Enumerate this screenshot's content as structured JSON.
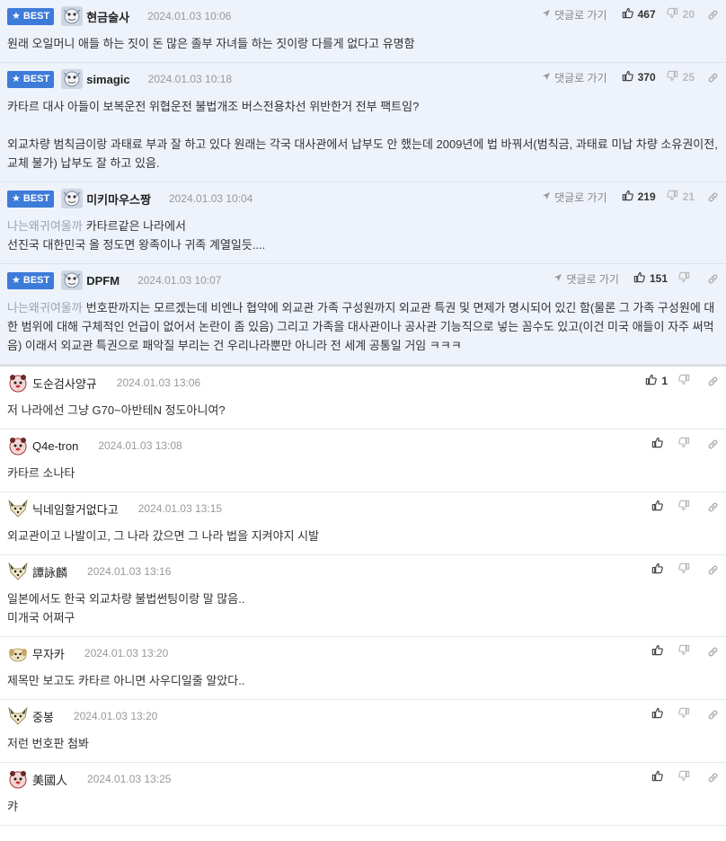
{
  "labels": {
    "best": "BEST",
    "reply": "댓글로 가기"
  },
  "colors": {
    "best_badge": "#3d7bd9",
    "best_bg": "#eef2fa",
    "mention": "#9aa3b5"
  },
  "best_comments": [
    {
      "nick": "현금술사",
      "date": "2024.01.03 10:06",
      "likes": "467",
      "dislikes": "20",
      "lines": [
        "원래 오일머니 애들 하는 짓이 돈 많은 졸부 자녀들 하는 짓이랑 다를게 없다고 유명함"
      ]
    },
    {
      "nick": "simagic",
      "date": "2024.01.03 10:18",
      "likes": "370",
      "dislikes": "25",
      "lines": [
        "카타르 대사 아들이 보복운전 위협운전 불법개조 버스전용차선 위반한거 전부 팩트임?",
        "",
        "외교차량 범칙금이랑 과태료 부과 잘 하고 있다 원래는 각국 대사관에서 납부도 안 했는데 2009년에 법 바꿔서(범칙금, 과태료 미납 차량 소유권이전, 교체 불가) 납부도 잘 하고 있음."
      ]
    },
    {
      "nick": "미키마우스짱",
      "date": "2024.01.03 10:04",
      "likes": "219",
      "dislikes": "21",
      "mention": "나는왜귀여울까",
      "lines": [
        "카타르같은 나라에서",
        "선진국 대한민국 올 정도면 왕족이나 귀족 계열일듯...."
      ]
    },
    {
      "nick": "DPFM",
      "date": "2024.01.03 10:07",
      "likes": "151",
      "dislikes": "",
      "mention": "나는왜귀여울까",
      "lines": [
        "번호판까지는 모르겠는데 비엔나 협약에 외교관 가족 구성원까지 외교관 특권 및 면제가 명시되어 있긴 함(물론 그 가족 구성원에 대한 범위에 대해 구체적인 언급이 없어서 논란이 좀 있음) 그리고 가족을 대사관이나 공사관 기능직으로 넣는 꼼수도 있고(이건 미국 애들이 자주 써먹음) 이래서 외교관 특권으로 패악질 부리는 건 우리나라뿐만 아니라 전 세계 공통일 거임 ㅋㅋㅋ"
      ]
    }
  ],
  "comments": [
    {
      "nick": "도순검사양규",
      "date": "2024.01.03 13:06",
      "likes": "1",
      "avatar": "pink",
      "lines": [
        "저 나라에선 그냥 G70~아반테N 정도아니여?"
      ]
    },
    {
      "nick": "Q4e-tron",
      "date": "2024.01.03 13:08",
      "likes": "",
      "avatar": "pink",
      "lines": [
        "카타르 소나타"
      ]
    },
    {
      "nick": "닉네임할거없다고",
      "date": "2024.01.03 13:15",
      "likes": "",
      "avatar": "fox",
      "lines": [
        "외교관이고 나발이고, 그 나라 갔으면 그 나라 법을 지켜야지 시발"
      ]
    },
    {
      "nick": "譚詠麟",
      "date": "2024.01.03 13:16",
      "likes": "",
      "avatar": "fox",
      "lines": [
        "일본에서도 한국 외교차량 불법썬팅이랑 말 많음..",
        "미개국 어쩌구"
      ]
    },
    {
      "nick": "무자카",
      "date": "2024.01.03 13:20",
      "likes": "",
      "avatar": "pup",
      "lines": [
        "제목만 보고도 카타르 아니면 사우디일줄 알았다.."
      ]
    },
    {
      "nick": "중봉",
      "date": "2024.01.03 13:20",
      "likes": "",
      "avatar": "fox",
      "lines": [
        "저런 번호판 첨봐"
      ]
    },
    {
      "nick": "美國人",
      "date": "2024.01.03 13:25",
      "likes": "",
      "avatar": "pink",
      "lines": [
        "캬"
      ]
    }
  ]
}
